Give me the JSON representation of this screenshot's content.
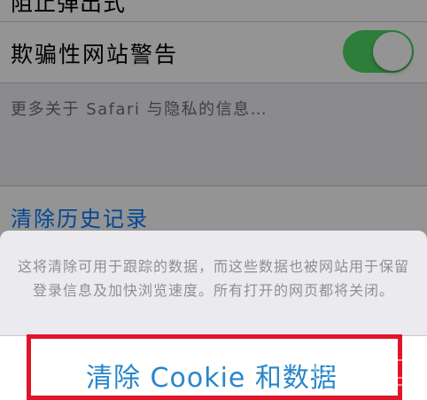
{
  "settings": {
    "partial_row_label": "阻止弹出式",
    "fraud_warning_label": "欺骗性网站警告",
    "fraud_warning_on": true,
    "more_info_text": "更多关于 Safari 与隐私的信息…",
    "clear_history_label": "清除历史记录"
  },
  "action_sheet": {
    "message": "这将清除可用于跟踪的数据，而这些数据也被网站用于保留登录信息及加快浏览速度。所有打开的网页都将关闭。",
    "clear_action_label": "清除 Cookie 和数据"
  },
  "colors": {
    "switch_on": "#4cd964",
    "link_blue": "#007aff",
    "highlight_red": "#e1152a"
  },
  "icons": {
    "watermark": "baidu-jingyan-watermark"
  }
}
